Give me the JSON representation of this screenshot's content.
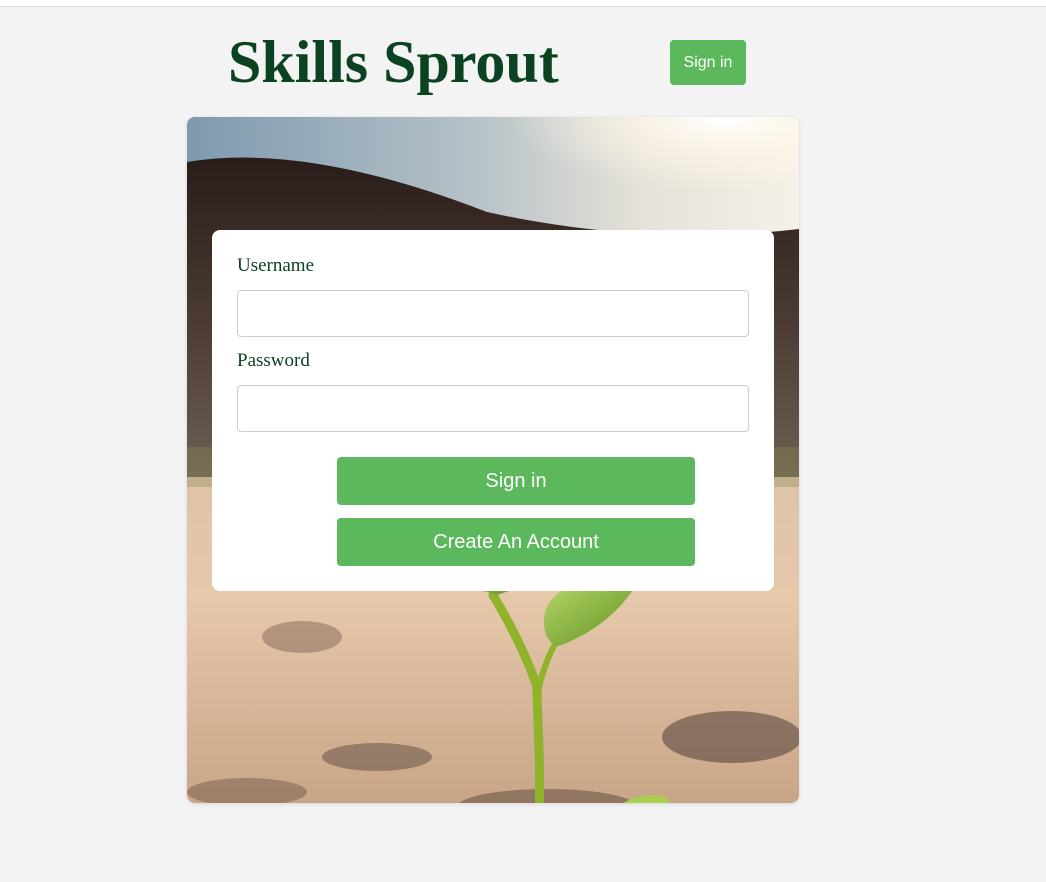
{
  "header": {
    "title": "Skills Sprout",
    "signin_label": "Sign in"
  },
  "hero": {
    "image": "seedling-sprout-photo"
  },
  "login_form": {
    "username_label": "Username",
    "username_value": "",
    "password_label": "Password",
    "password_value": "",
    "signin_label": "Sign in",
    "create_account_label": "Create An Account"
  },
  "colors": {
    "brand_green": "#0b4222",
    "button_green": "#5cb85c",
    "page_background": "#f3f3f3"
  }
}
